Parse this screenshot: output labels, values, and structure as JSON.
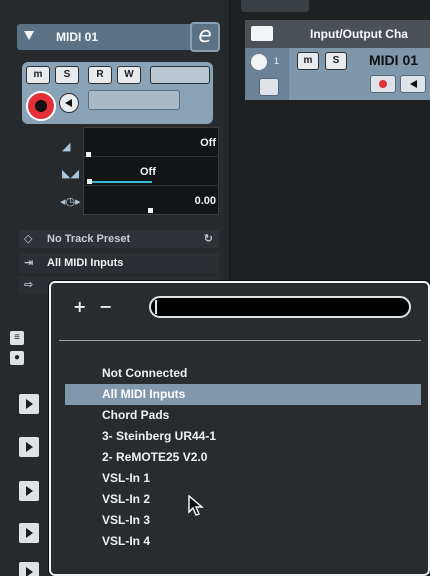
{
  "track": {
    "name": "MIDI 01",
    "edit_label": "e",
    "mute": "m",
    "solo": "S",
    "read": "R",
    "write": "W"
  },
  "inspector": {
    "volume_value": "Off",
    "pan_value": "Off",
    "delay_value": "0.00",
    "preset_label": "No Track Preset",
    "midi_input": "All MIDI Inputs"
  },
  "tracklist": {
    "column_title": "Input/Output Cha",
    "track_number": "1",
    "track_name": "MIDI 01",
    "mute": "m",
    "solo": "S"
  },
  "popup": {
    "plus": "+",
    "minus": "−",
    "search_value": "",
    "items": [
      "Not Connected",
      "All MIDI Inputs",
      "Chord Pads",
      "3- Steinberg UR44-1",
      "2- ReMOTE25 V2.0",
      "VSL-In 1",
      "VSL-In 2",
      "VSL-In 3",
      "VSL-In 4"
    ],
    "selected_index": 1
  },
  "colors": {
    "track_header": "#5b7184",
    "control_panel": "#8aa2b5",
    "selection": "#8197ab",
    "record": "#e3313a"
  },
  "icons": [
    "folder-icon",
    "midi-port-icon",
    "record-icon",
    "monitor-icon",
    "volume-icon",
    "pan-icon",
    "delay-icon",
    "preset-icon",
    "input-icon",
    "output-icon",
    "pointer-cursor-icon"
  ]
}
